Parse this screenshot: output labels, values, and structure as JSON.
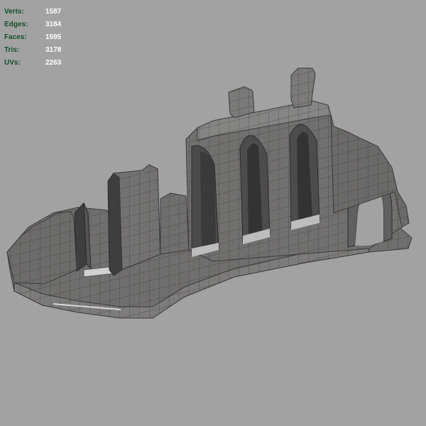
{
  "viewport": {
    "background": "#a2a2a2",
    "stats": [
      {
        "label": "Verts:",
        "value": "1587"
      },
      {
        "label": "Edges:",
        "value": "3184"
      },
      {
        "label": "Faces:",
        "value": "1595"
      },
      {
        "label": "Tris:",
        "value": "3178"
      },
      {
        "label": "UVs:",
        "value": "2263"
      }
    ]
  },
  "colors": {
    "label": "#13502a",
    "value": "#ffffff",
    "mesh_face": "#6f6f6f",
    "mesh_face_light": "#858585",
    "mesh_face_dark": "#3e3e3e",
    "wire": "#4a2525"
  }
}
